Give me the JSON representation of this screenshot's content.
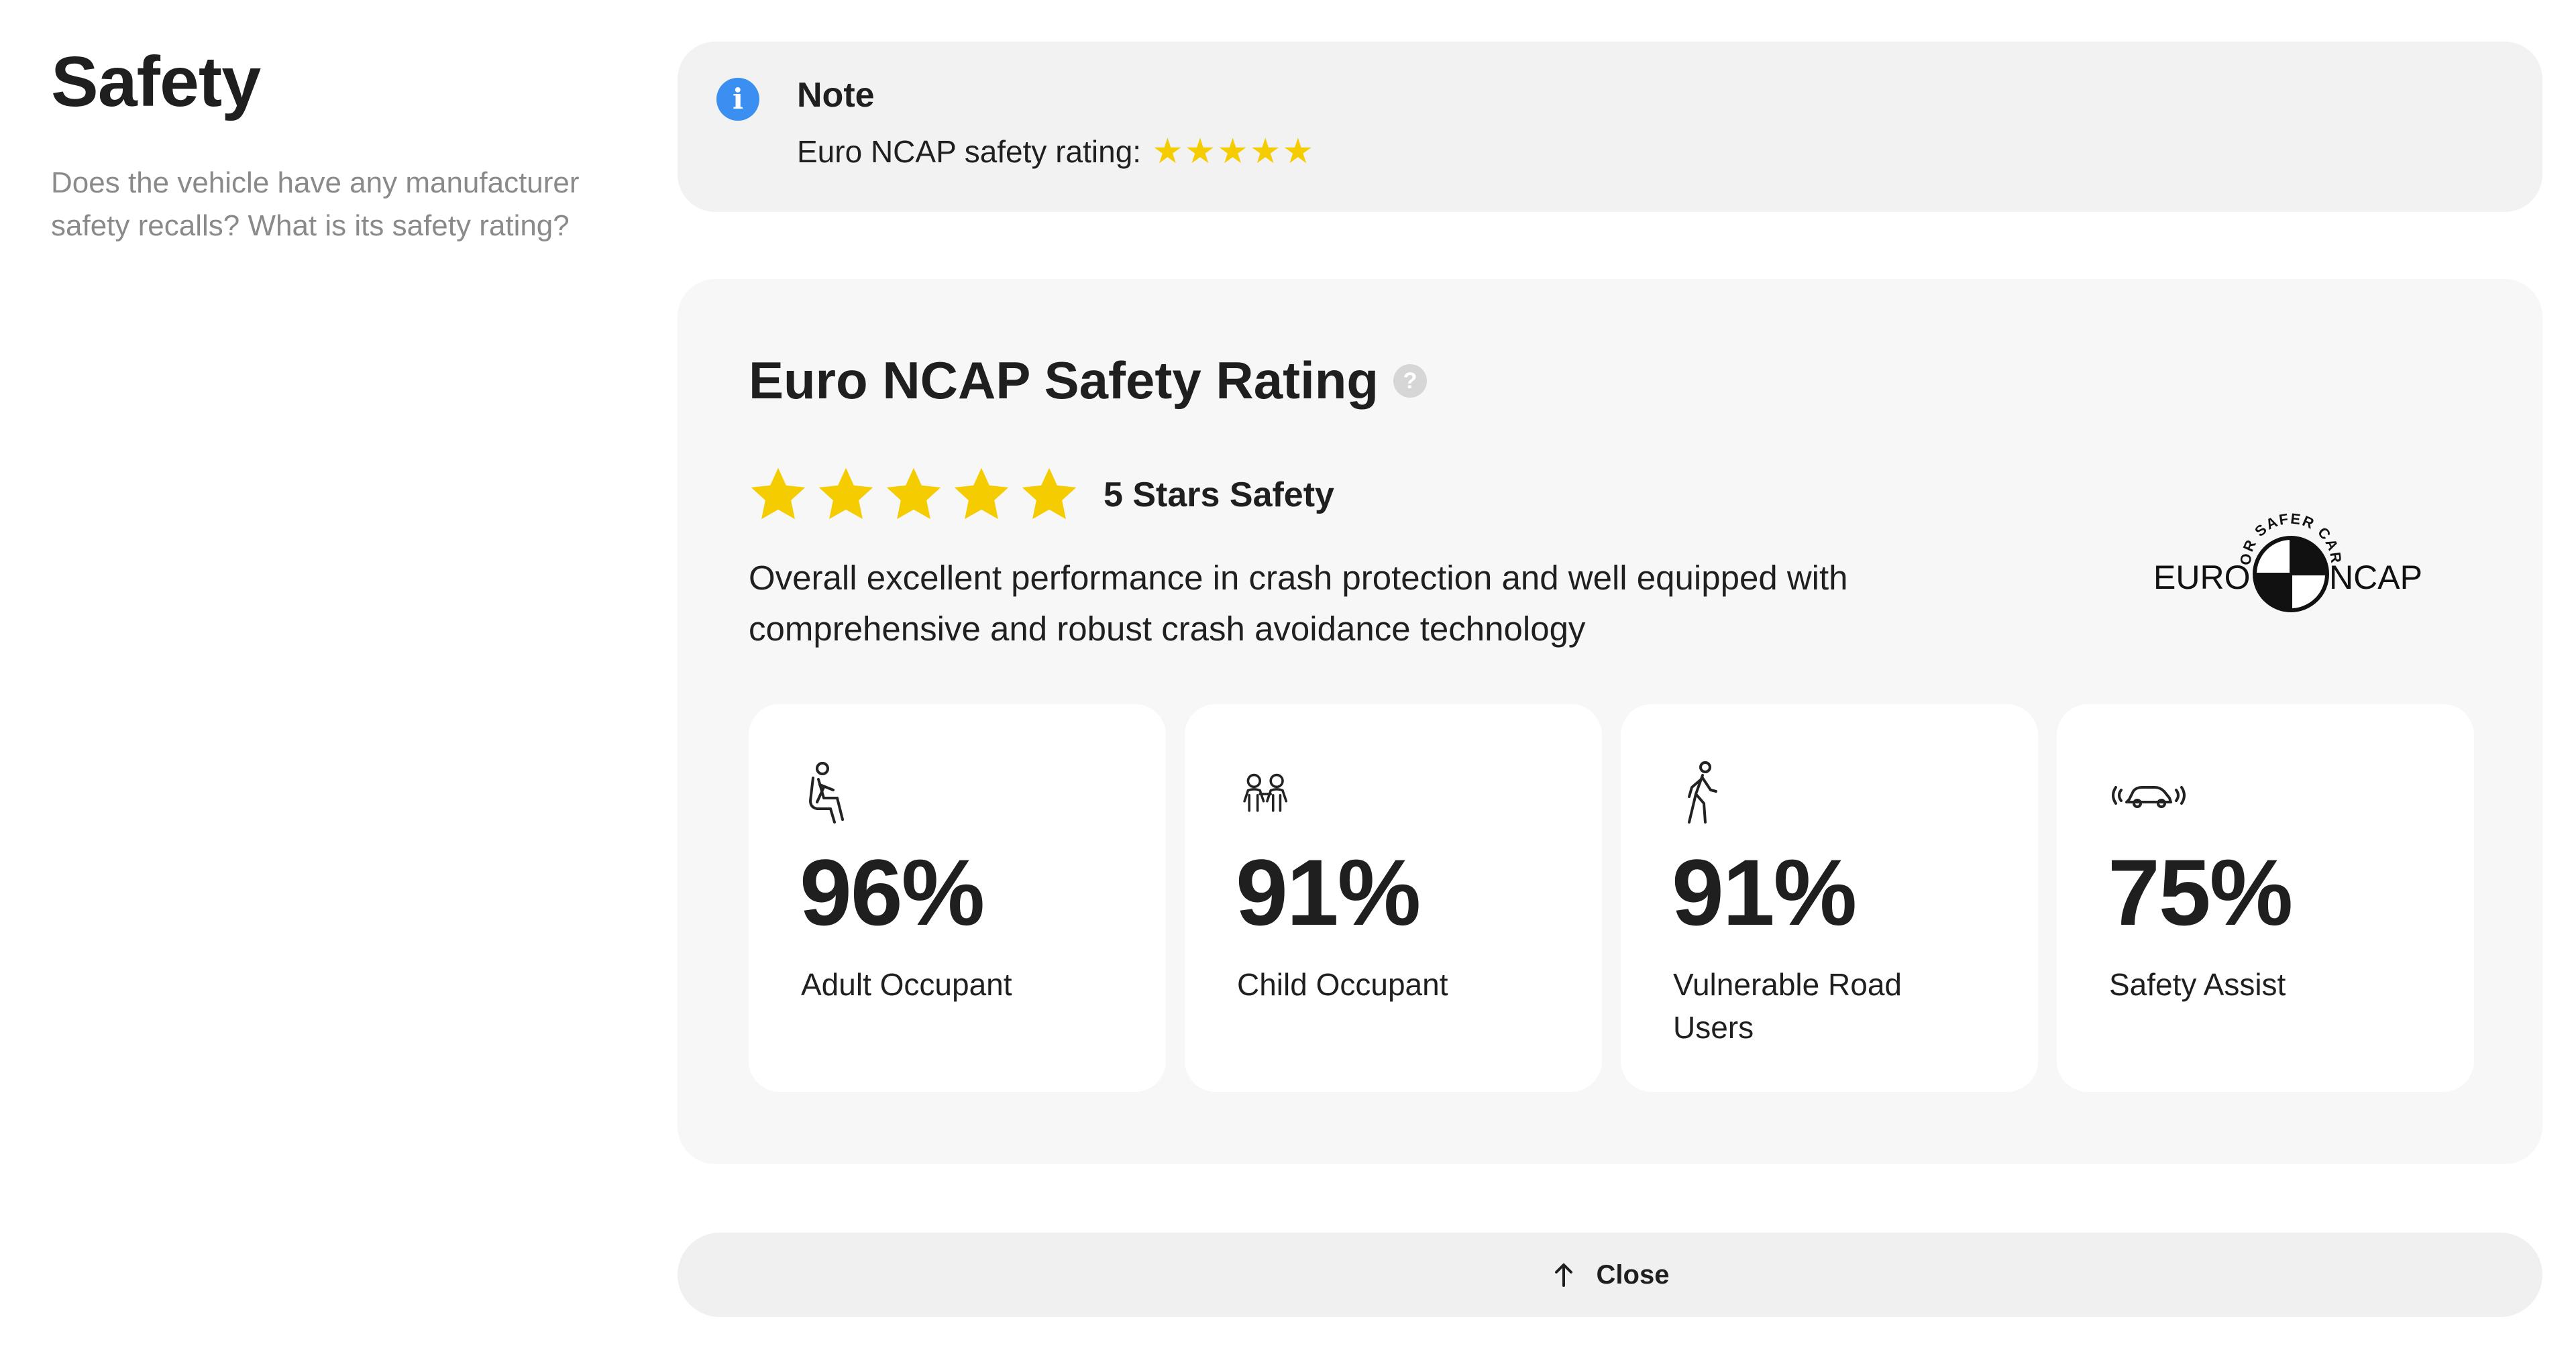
{
  "section": {
    "title": "Safety",
    "description": "Does the vehicle have any manufacturer safety recalls? What is its safety rating?"
  },
  "note": {
    "icon": "info-icon",
    "title": "Note",
    "body": "Euro NCAP safety rating:",
    "stars": "★★★★★",
    "star_count": 5,
    "star_color": "#f5cc00",
    "icon_color": "#3b8ff0"
  },
  "rating": {
    "title": "Euro NCAP Safety Rating",
    "help_icon": "help-icon",
    "help_glyph": "?",
    "stars_count": 5,
    "stars_label": "5 Stars Safety",
    "description": "Overall excellent performance in crash protection and well equipped with comprehensive and robust crash avoidance technology",
    "logo": {
      "arc_text": "FOR SAFER CARS",
      "left_text": "EURO",
      "right_text": "NCAP"
    }
  },
  "stats": [
    {
      "icon": "adult-occupant-icon",
      "value": "96%",
      "label": "Adult Occupant"
    },
    {
      "icon": "child-occupant-icon",
      "value": "91%",
      "label": "Child Occupant"
    },
    {
      "icon": "pedestrian-icon",
      "value": "91%",
      "label": "Vulnerable Road Users"
    },
    {
      "icon": "car-sensor-icon",
      "value": "75%",
      "label": "Safety Assist"
    }
  ],
  "close": {
    "icon": "arrow-up-icon",
    "label": "Close"
  }
}
